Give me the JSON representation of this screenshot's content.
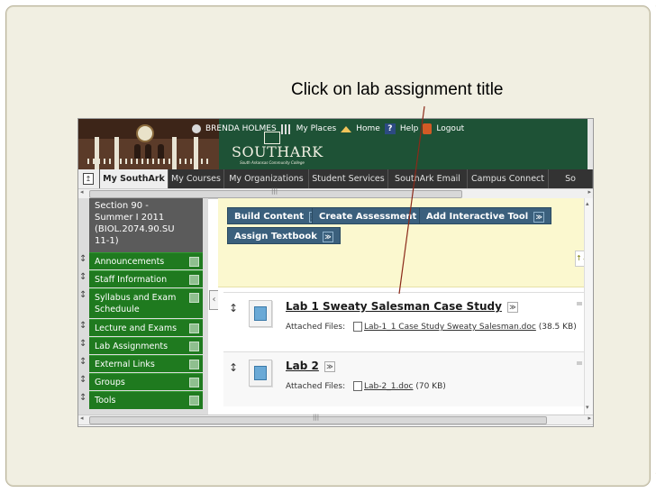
{
  "callout": {
    "text": "Click on lab assignment title"
  },
  "header": {
    "user": "BRENDA HOLMES",
    "my_places": "My Places",
    "home": "Home",
    "help": "Help",
    "logout": "Logout",
    "logo_name": "SOUTHARK",
    "logo_tag": "South Arkansas Community College",
    "header_color": "#1e5236"
  },
  "tabs": [
    {
      "label": "My SouthArk",
      "active": true
    },
    {
      "label": "My Courses"
    },
    {
      "label": "My Organizations"
    },
    {
      "label": "Student Services"
    },
    {
      "label": "SouthArk Email"
    },
    {
      "label": "Campus Connect"
    },
    {
      "label": "So"
    }
  ],
  "course": {
    "title": "Section 90 -\nSummer I 2011\n(BIOL.2074.90.SU\n11-1)"
  },
  "menu": [
    {
      "label": "Announcements"
    },
    {
      "label": "Staff Information"
    },
    {
      "label": "Syllabus and Exam Scheduule"
    },
    {
      "label": "Lecture and Exams"
    },
    {
      "label": "Lab Assignments"
    },
    {
      "label": "External Links"
    },
    {
      "label": "Groups"
    },
    {
      "label": "Tools"
    }
  ],
  "toolbar": {
    "build_content": "Build Content",
    "create_assessment": "Create Assessment",
    "add_interactive_tool": "Add Interactive Tool",
    "assign_textbook": "Assign Textbook",
    "chevron": "≫"
  },
  "items": [
    {
      "title": "Lab 1 Sweaty Salesman Case Study",
      "attached_label": "Attached Files:",
      "file": "Lab-1_1 Case Study Sweaty Salesman.doc",
      "size": "(38.5 KB)"
    },
    {
      "title": "Lab 2",
      "attached_label": "Attached Files:",
      "file": "Lab-2_1.doc",
      "size": "(70 KB)"
    }
  ],
  "colors": {
    "menu_green": "#1f7a1f",
    "button_blue": "#3b607d",
    "toolbar_yellow": "#fbf8cf",
    "callout_line": "#8b2a1a"
  }
}
